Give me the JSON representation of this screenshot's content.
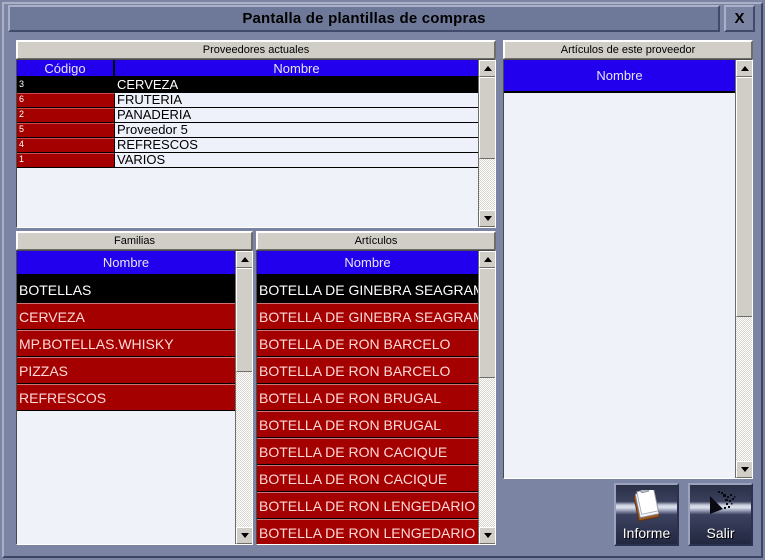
{
  "window": {
    "title": "Pantalla de plantillas de compras",
    "close_label": "X"
  },
  "panels": {
    "proveedores": {
      "caption": "Proveedores actuales",
      "columns": [
        "Código",
        "Nombre"
      ],
      "rows": [
        {
          "codigo": "3",
          "nombre": "CERVEZA",
          "state": "selected"
        },
        {
          "codigo": "6",
          "nombre": "FRUTERIA",
          "state": "normal"
        },
        {
          "codigo": "2",
          "nombre": "PANADERIA",
          "state": "normal"
        },
        {
          "codigo": "5",
          "nombre": "Proveedor  5",
          "state": "normal"
        },
        {
          "codigo": "4",
          "nombre": "REFRESCOS",
          "state": "normal"
        },
        {
          "codigo": "1",
          "nombre": "VARIOS",
          "state": "normal"
        }
      ]
    },
    "articulos_proveedor": {
      "caption": "Artículos de este proveedor",
      "columns": [
        "Nombre"
      ],
      "rows": []
    },
    "familias": {
      "caption": "Familias",
      "columns": [
        "Nombre"
      ],
      "rows": [
        {
          "nombre": "BOTELLAS",
          "state": "selected"
        },
        {
          "nombre": "CERVEZA",
          "state": "normal"
        },
        {
          "nombre": "MP.BOTELLAS.WHISKY",
          "state": "normal"
        },
        {
          "nombre": "PIZZAS",
          "state": "normal"
        },
        {
          "nombre": "REFRESCOS",
          "state": "normal"
        }
      ]
    },
    "articulos": {
      "caption": "Artículos",
      "columns": [
        "Nombre"
      ],
      "rows": [
        {
          "nombre": "BOTELLA DE GINEBRA SEAGRAMS",
          "state": "selected"
        },
        {
          "nombre": "BOTELLA DE GINEBRA SEAGRAMS",
          "state": "normal"
        },
        {
          "nombre": "BOTELLA DE RON BARCELO",
          "state": "normal"
        },
        {
          "nombre": "BOTELLA DE RON BARCELO",
          "state": "normal"
        },
        {
          "nombre": "BOTELLA DE RON BRUGAL",
          "state": "normal"
        },
        {
          "nombre": "BOTELLA DE RON BRUGAL",
          "state": "normal"
        },
        {
          "nombre": "BOTELLA DE RON CACIQUE",
          "state": "normal"
        },
        {
          "nombre": "BOTELLA DE RON CACIQUE",
          "state": "normal"
        },
        {
          "nombre": "BOTELLA DE RON LENGEDARIO",
          "state": "normal"
        },
        {
          "nombre": "BOTELLA DE RON LENGEDARIO",
          "state": "normal"
        }
      ]
    }
  },
  "toolbar": {
    "informe_label": "Informe",
    "informe_icon": "clipboard-icon",
    "salir_label": "Salir",
    "salir_icon": "exit-arrow-icon"
  },
  "colors": {
    "background": "#7c84a4",
    "titlebar": "#6e7898",
    "panel_caption": "#d0cec7",
    "grid_header": "#2200ee",
    "row_red": "#a50000",
    "row_selected": "#000000",
    "row_light": "#eef1fa"
  }
}
